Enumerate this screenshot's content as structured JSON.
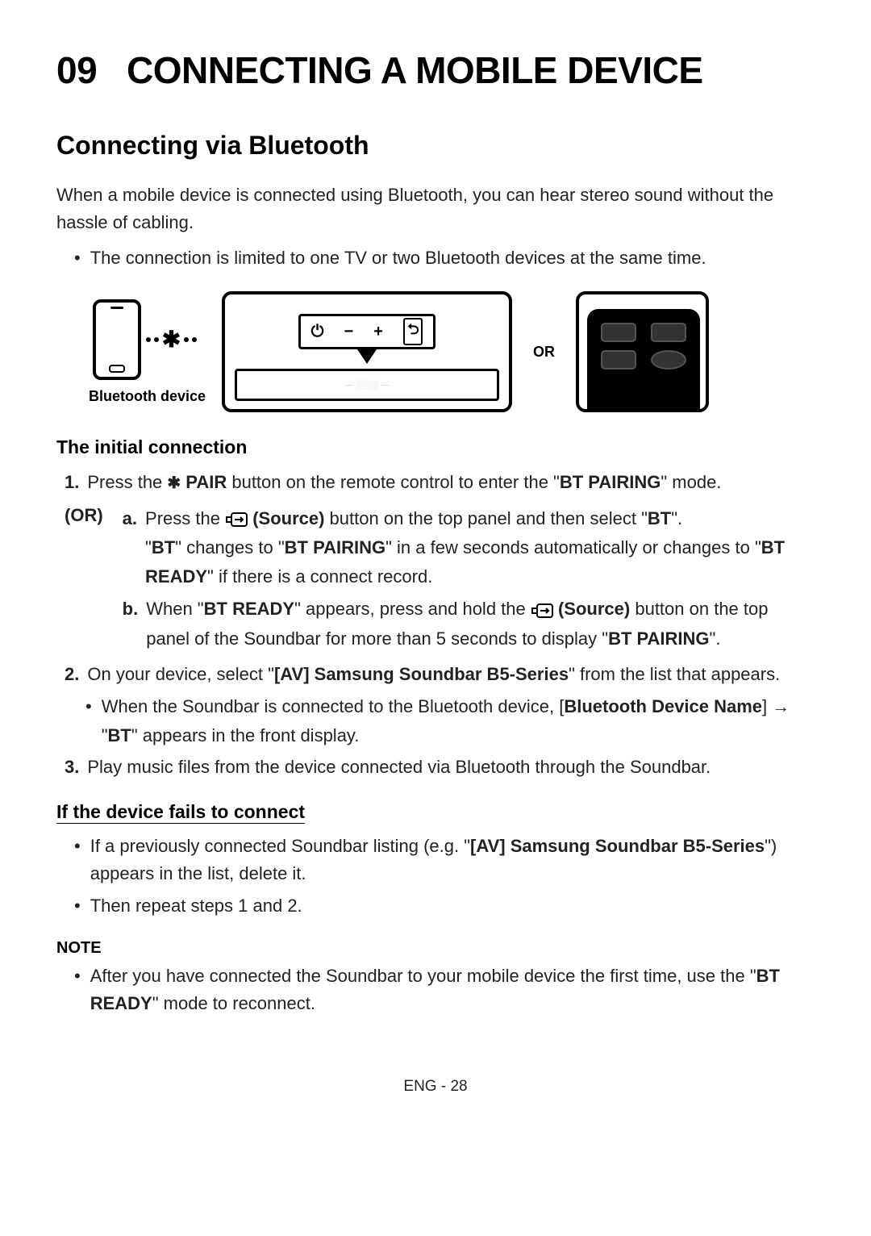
{
  "chapter": {
    "num": "09",
    "title": "CONNECTING A MOBILE DEVICE"
  },
  "section": {
    "h2": "Connecting via Bluetooth",
    "intro": "When a mobile device is connected using Bluetooth, you can hear stereo sound without the hassle of cabling.",
    "intro_bullet": "The connection is limited to one TV or two Bluetooth devices at the same time."
  },
  "diagram": {
    "bt_device_label": "Bluetooth device",
    "or": "OR"
  },
  "initial": {
    "heading": "The initial connection",
    "step1_prefix": "Press the ",
    "step1_pair": "PAIR",
    "step1_mid": " button on the remote control to enter the \"",
    "step1_mode": "BT PAIRING",
    "step1_suffix": "\" mode.",
    "or_label": "(OR)",
    "a_prefix": "Press the ",
    "a_source": "(Source)",
    "a_mid": " button on the top panel and then select \"",
    "a_bt": "BT",
    "a_suffix": "\".",
    "a_line2_q1": "\"",
    "a_line2_bt": "BT",
    "a_line2_m1": "\" changes to \"",
    "a_line2_pairing": "BT PAIRING",
    "a_line2_m2": "\" in a few seconds automatically or changes to \"",
    "a_line2_ready": "BT READY",
    "a_line2_end": "\" if there is a connect record.",
    "b_prefix": "When \"",
    "b_ready": "BT READY",
    "b_mid1": "\" appears, press and hold the ",
    "b_source": "(Source)",
    "b_mid2": " button on the top panel of the Soundbar for more than 5 seconds to display \"",
    "b_pairing": "BT PAIRING",
    "b_suffix": "\".",
    "step2_prefix": "On your device, select \"",
    "step2_name": "[AV] Samsung Soundbar B5-Series",
    "step2_suffix": "\" from the list that appears.",
    "step2_bullet_prefix": "When the Soundbar is connected to the Bluetooth device, [",
    "step2_bullet_bdn": "Bluetooth Device Name",
    "step2_bullet_mid": "] → \"",
    "step2_bullet_bt": "BT",
    "step2_bullet_suffix": "\" appears in the front display.",
    "step3": "Play music files from the device connected via Bluetooth through the Soundbar."
  },
  "fails": {
    "heading": "If the device fails to connect",
    "b1_prefix": "If a previously connected Soundbar listing (e.g. \"",
    "b1_name": "[AV] Samsung Soundbar B5-Series",
    "b1_suffix": "\") appears in the list, delete it.",
    "b2": "Then repeat steps 1 and 2."
  },
  "note": {
    "label": "NOTE",
    "b_prefix": "After you have connected the Soundbar to your mobile device the first time, use the \"",
    "b_ready": "BT READY",
    "b_suffix": "\" mode to reconnect."
  },
  "footer": "ENG - 28",
  "labels": {
    "num1": "1.",
    "num2": "2.",
    "num3": "3.",
    "la": "a.",
    "lb": "b.",
    "bullet": "•"
  }
}
